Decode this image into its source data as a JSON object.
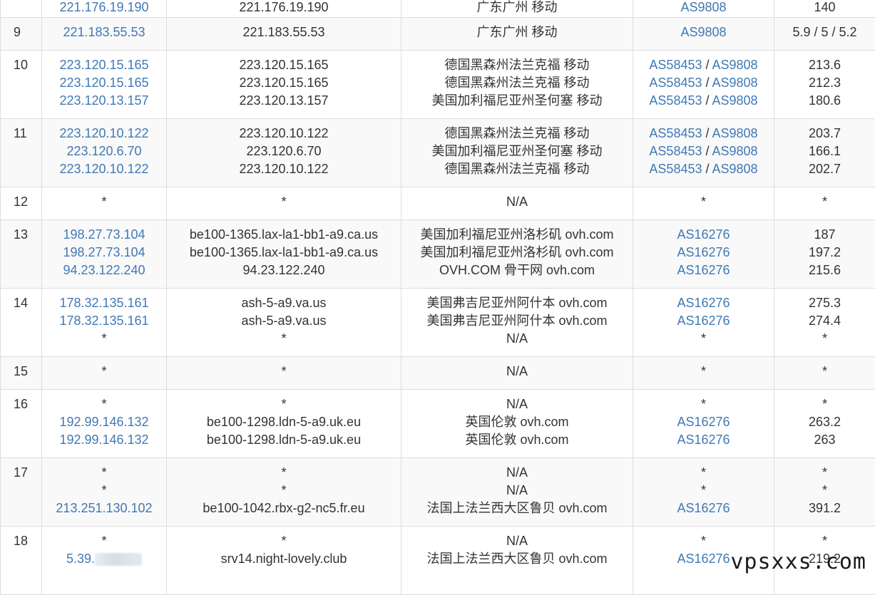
{
  "rows": [
    {
      "hop": "",
      "height": 35,
      "ips": [
        "221.176.19.190"
      ],
      "hosts": [
        "221.176.19.190"
      ],
      "locs": [
        "广东广州 移动"
      ],
      "as": [
        [
          "AS9808"
        ]
      ],
      "times": [
        "140"
      ]
    },
    {
      "hop": "9",
      "height": 46,
      "ips": [
        "221.183.55.53"
      ],
      "hosts": [
        "221.183.55.53"
      ],
      "locs": [
        "广东广州 移动"
      ],
      "as": [
        [
          "AS9808"
        ]
      ],
      "times": [
        "5.9 / 5 / 5.2"
      ]
    },
    {
      "hop": "10",
      "height": 96,
      "ips": [
        "223.120.15.165",
        "223.120.15.165",
        "223.120.13.157"
      ],
      "hosts": [
        "223.120.15.165",
        "223.120.15.165",
        "223.120.13.157"
      ],
      "locs": [
        "德国黑森州法兰克福 移动",
        "德国黑森州法兰克福 移动",
        "美国加利福尼亚州圣何塞 移动"
      ],
      "as": [
        [
          "AS58453",
          "AS9808"
        ],
        [
          "AS58453",
          "AS9808"
        ],
        [
          "AS58453",
          "AS9808"
        ]
      ],
      "times": [
        "213.6",
        "212.3",
        "180.6"
      ]
    },
    {
      "hop": "11",
      "height": 96,
      "ips": [
        "223.120.10.122",
        "223.120.6.70",
        "223.120.10.122"
      ],
      "hosts": [
        "223.120.10.122",
        "223.120.6.70",
        "223.120.10.122"
      ],
      "locs": [
        "德国黑森州法兰克福 移动",
        "美国加利福尼亚州圣何塞 移动",
        "德国黑森州法兰克福 移动"
      ],
      "as": [
        [
          "AS58453",
          "AS9808"
        ],
        [
          "AS58453",
          "AS9808"
        ],
        [
          "AS58453",
          "AS9808"
        ]
      ],
      "times": [
        "203.7",
        "166.1",
        "202.7"
      ]
    },
    {
      "hop": "12",
      "height": 46,
      "ips": [
        "*"
      ],
      "hosts": [
        "*"
      ],
      "locs": [
        "N/A"
      ],
      "as": [
        [
          "*"
        ]
      ],
      "times": [
        "*"
      ]
    },
    {
      "hop": "13",
      "height": 96,
      "ips": [
        "198.27.73.104",
        "198.27.73.104",
        "94.23.122.240"
      ],
      "hosts": [
        "be100-1365.lax-la1-bb1-a9.ca.us",
        "be100-1365.lax-la1-bb1-a9.ca.us",
        "94.23.122.240"
      ],
      "locs": [
        "美国加利福尼亚州洛杉矶 ovh.com",
        "美国加利福尼亚州洛杉矶 ovh.com",
        "OVH.COM 骨干网 ovh.com"
      ],
      "as": [
        [
          "AS16276"
        ],
        [
          "AS16276"
        ],
        [
          "AS16276"
        ]
      ],
      "times": [
        "187",
        "197.2",
        "215.6"
      ]
    },
    {
      "hop": "14",
      "height": 96,
      "ips": [
        "178.32.135.161",
        "178.32.135.161",
        "*"
      ],
      "hosts": [
        "ash-5-a9.va.us",
        "ash-5-a9.va.us",
        "*"
      ],
      "locs": [
        "美国弗吉尼亚州阿什本 ovh.com",
        "美国弗吉尼亚州阿什本 ovh.com",
        "N/A"
      ],
      "as": [
        [
          "AS16276"
        ],
        [
          "AS16276"
        ],
        [
          "*"
        ]
      ],
      "times": [
        "275.3",
        "274.4",
        "*"
      ]
    },
    {
      "hop": "15",
      "height": 46,
      "ips": [
        "*"
      ],
      "hosts": [
        "*"
      ],
      "locs": [
        "N/A"
      ],
      "as": [
        [
          "*"
        ]
      ],
      "times": [
        "*"
      ]
    },
    {
      "hop": "16",
      "height": 96,
      "ips": [
        "*",
        "192.99.146.132",
        "192.99.146.132"
      ],
      "hosts": [
        "*",
        "be100-1298.ldn-5-a9.uk.eu",
        "be100-1298.ldn-5-a9.uk.eu"
      ],
      "locs": [
        "N/A",
        "英国伦敦 ovh.com",
        "英国伦敦 ovh.com"
      ],
      "as": [
        [
          "*"
        ],
        [
          "AS16276"
        ],
        [
          "AS16276"
        ]
      ],
      "times": [
        "*",
        "263.2",
        "263"
      ]
    },
    {
      "hop": "17",
      "height": 96,
      "ips": [
        "*",
        "*",
        "213.251.130.102"
      ],
      "hosts": [
        "*",
        "*",
        "be100-1042.rbx-g2-nc5.fr.eu"
      ],
      "locs": [
        "N/A",
        "N/A",
        "法国上法兰西大区鲁贝 ovh.com"
      ],
      "as": [
        [
          "*"
        ],
        [
          "*"
        ],
        [
          "AS16276"
        ]
      ],
      "times": [
        "*",
        "*",
        "391.2"
      ]
    },
    {
      "hop": "18",
      "height": 96,
      "ips": [
        "*",
        "5.39."
      ],
      "hosts": [
        "*",
        "srv14.night-lovely.club"
      ],
      "locs": [
        "N/A",
        "法国上法兰西大区鲁贝 ovh.com"
      ],
      "as": [
        [
          "*"
        ],
        [
          "AS16276"
        ]
      ],
      "times": [
        "*",
        "219.2"
      ],
      "masked_ip_row": 1
    }
  ],
  "watermark": "vpsxxs.com",
  "colors": {
    "link": "#3f79b5",
    "border": "#dddddd",
    "alt_row": "#f9f9f9",
    "text": "#333333"
  }
}
